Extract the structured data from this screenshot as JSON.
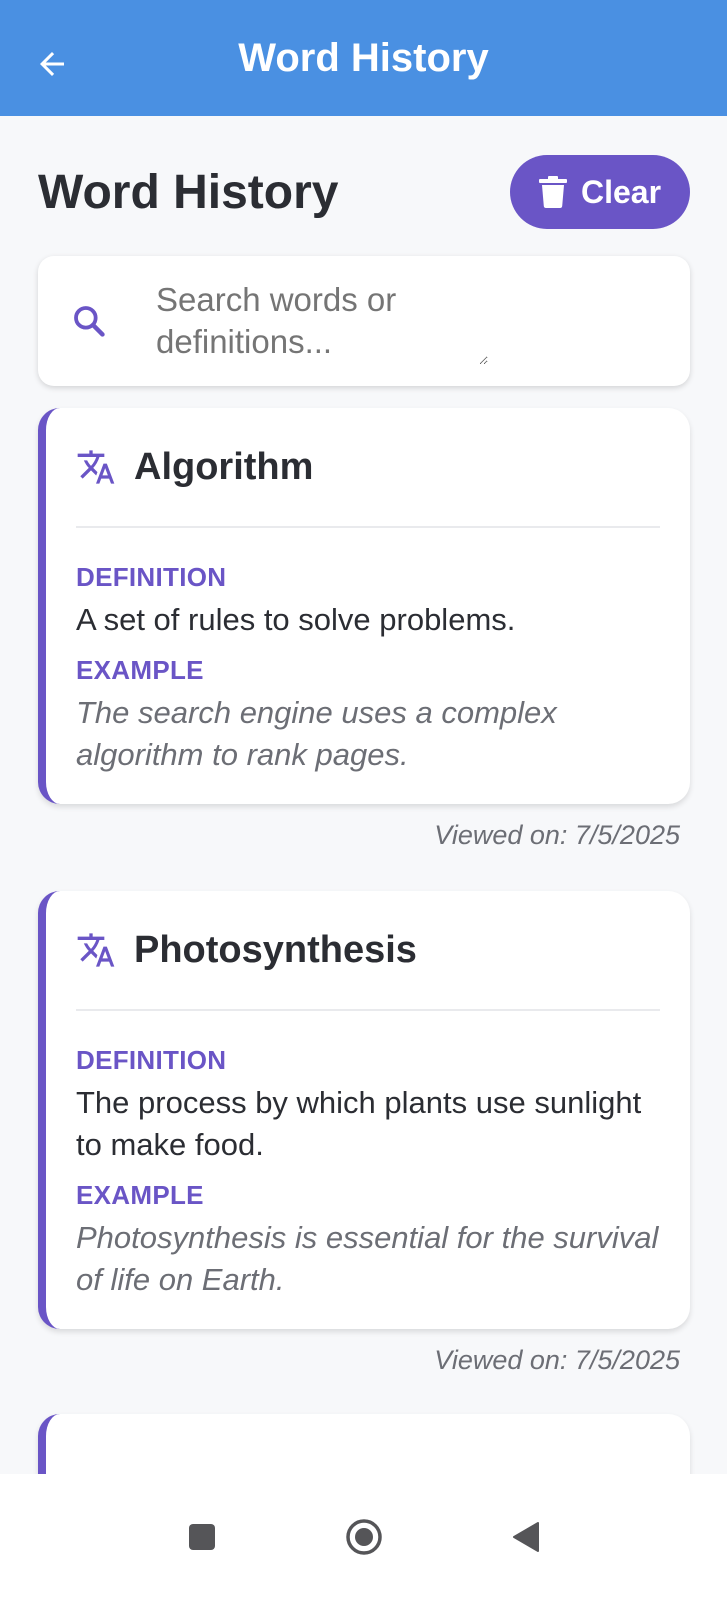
{
  "appbar": {
    "title": "Word History",
    "back_icon": "arrow-left-icon"
  },
  "header": {
    "title": "Word History",
    "clear_label": "Clear",
    "clear_icon": "trash-icon"
  },
  "search": {
    "placeholder": "Search words or definitions...",
    "icon": "search-icon"
  },
  "labels": {
    "definition": "DEFINITION",
    "example": "EXAMPLE"
  },
  "entries": [
    {
      "word": "Algorithm",
      "definition": "A set of rules to solve problems.",
      "example": "The search engine uses a complex algorithm to rank pages.",
      "viewed": "Viewed on: 7/5/2025"
    },
    {
      "word": "Photosynthesis",
      "definition": "The process by which plants use sunlight to make food.",
      "example": "Photosynthesis is essential for the survival of life on Earth.",
      "viewed": "Viewed on: 7/5/2025"
    }
  ],
  "colors": {
    "appbar": "#4a90e2",
    "accent": "#6a55c6",
    "background": "#f7f8fa"
  },
  "nav": {
    "icons": [
      "recents-icon",
      "home-icon",
      "back-triangle-icon"
    ]
  }
}
